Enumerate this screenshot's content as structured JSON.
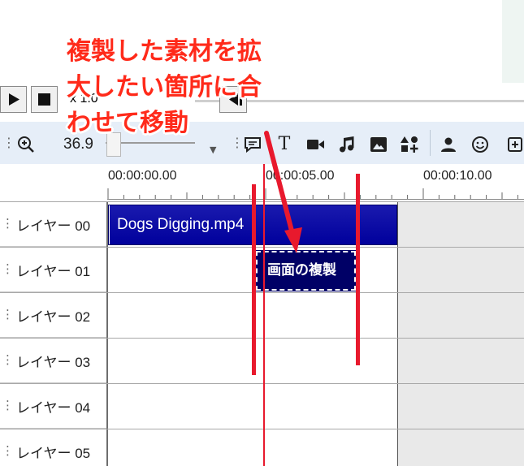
{
  "transport": {
    "play_icon": "play-icon",
    "stop_icon": "stop-icon",
    "speed": "x 1.0"
  },
  "toolbar": {
    "zoom_icon": "zoom-in-icon",
    "zoom_value": "36.9",
    "tools": [
      {
        "icon": "comment-icon"
      },
      {
        "icon": "text-icon",
        "glyph": "T"
      },
      {
        "icon": "video-camera-icon"
      },
      {
        "icon": "music-note-icon"
      },
      {
        "icon": "image-icon"
      },
      {
        "icon": "shapes-add-icon"
      },
      {
        "icon": "person-icon"
      },
      {
        "icon": "smiley-icon"
      },
      {
        "icon": "add-item-icon"
      }
    ]
  },
  "ruler": {
    "times": [
      "00:00:00.00",
      "00:00:05.00",
      "00:00:10.00"
    ]
  },
  "layers": [
    {
      "name": "レイヤー 00"
    },
    {
      "name": "レイヤー 01"
    },
    {
      "name": "レイヤー 02"
    },
    {
      "name": "レイヤー 03"
    },
    {
      "name": "レイヤー 04"
    },
    {
      "name": "レイヤー 05"
    }
  ],
  "clips": {
    "video": "Dogs Digging.mp4",
    "copy": "画面の複製"
  },
  "annotation": {
    "lines": [
      "複製した素材を拡",
      "大したい箇所に合",
      "わせて移動"
    ],
    "color": "#ff2a1a"
  },
  "colors": {
    "clip_video": "#0000a8",
    "clip_copy": "#000066",
    "annotation_red": "#e8192d",
    "toolbar_bg": "#e6eef8"
  }
}
